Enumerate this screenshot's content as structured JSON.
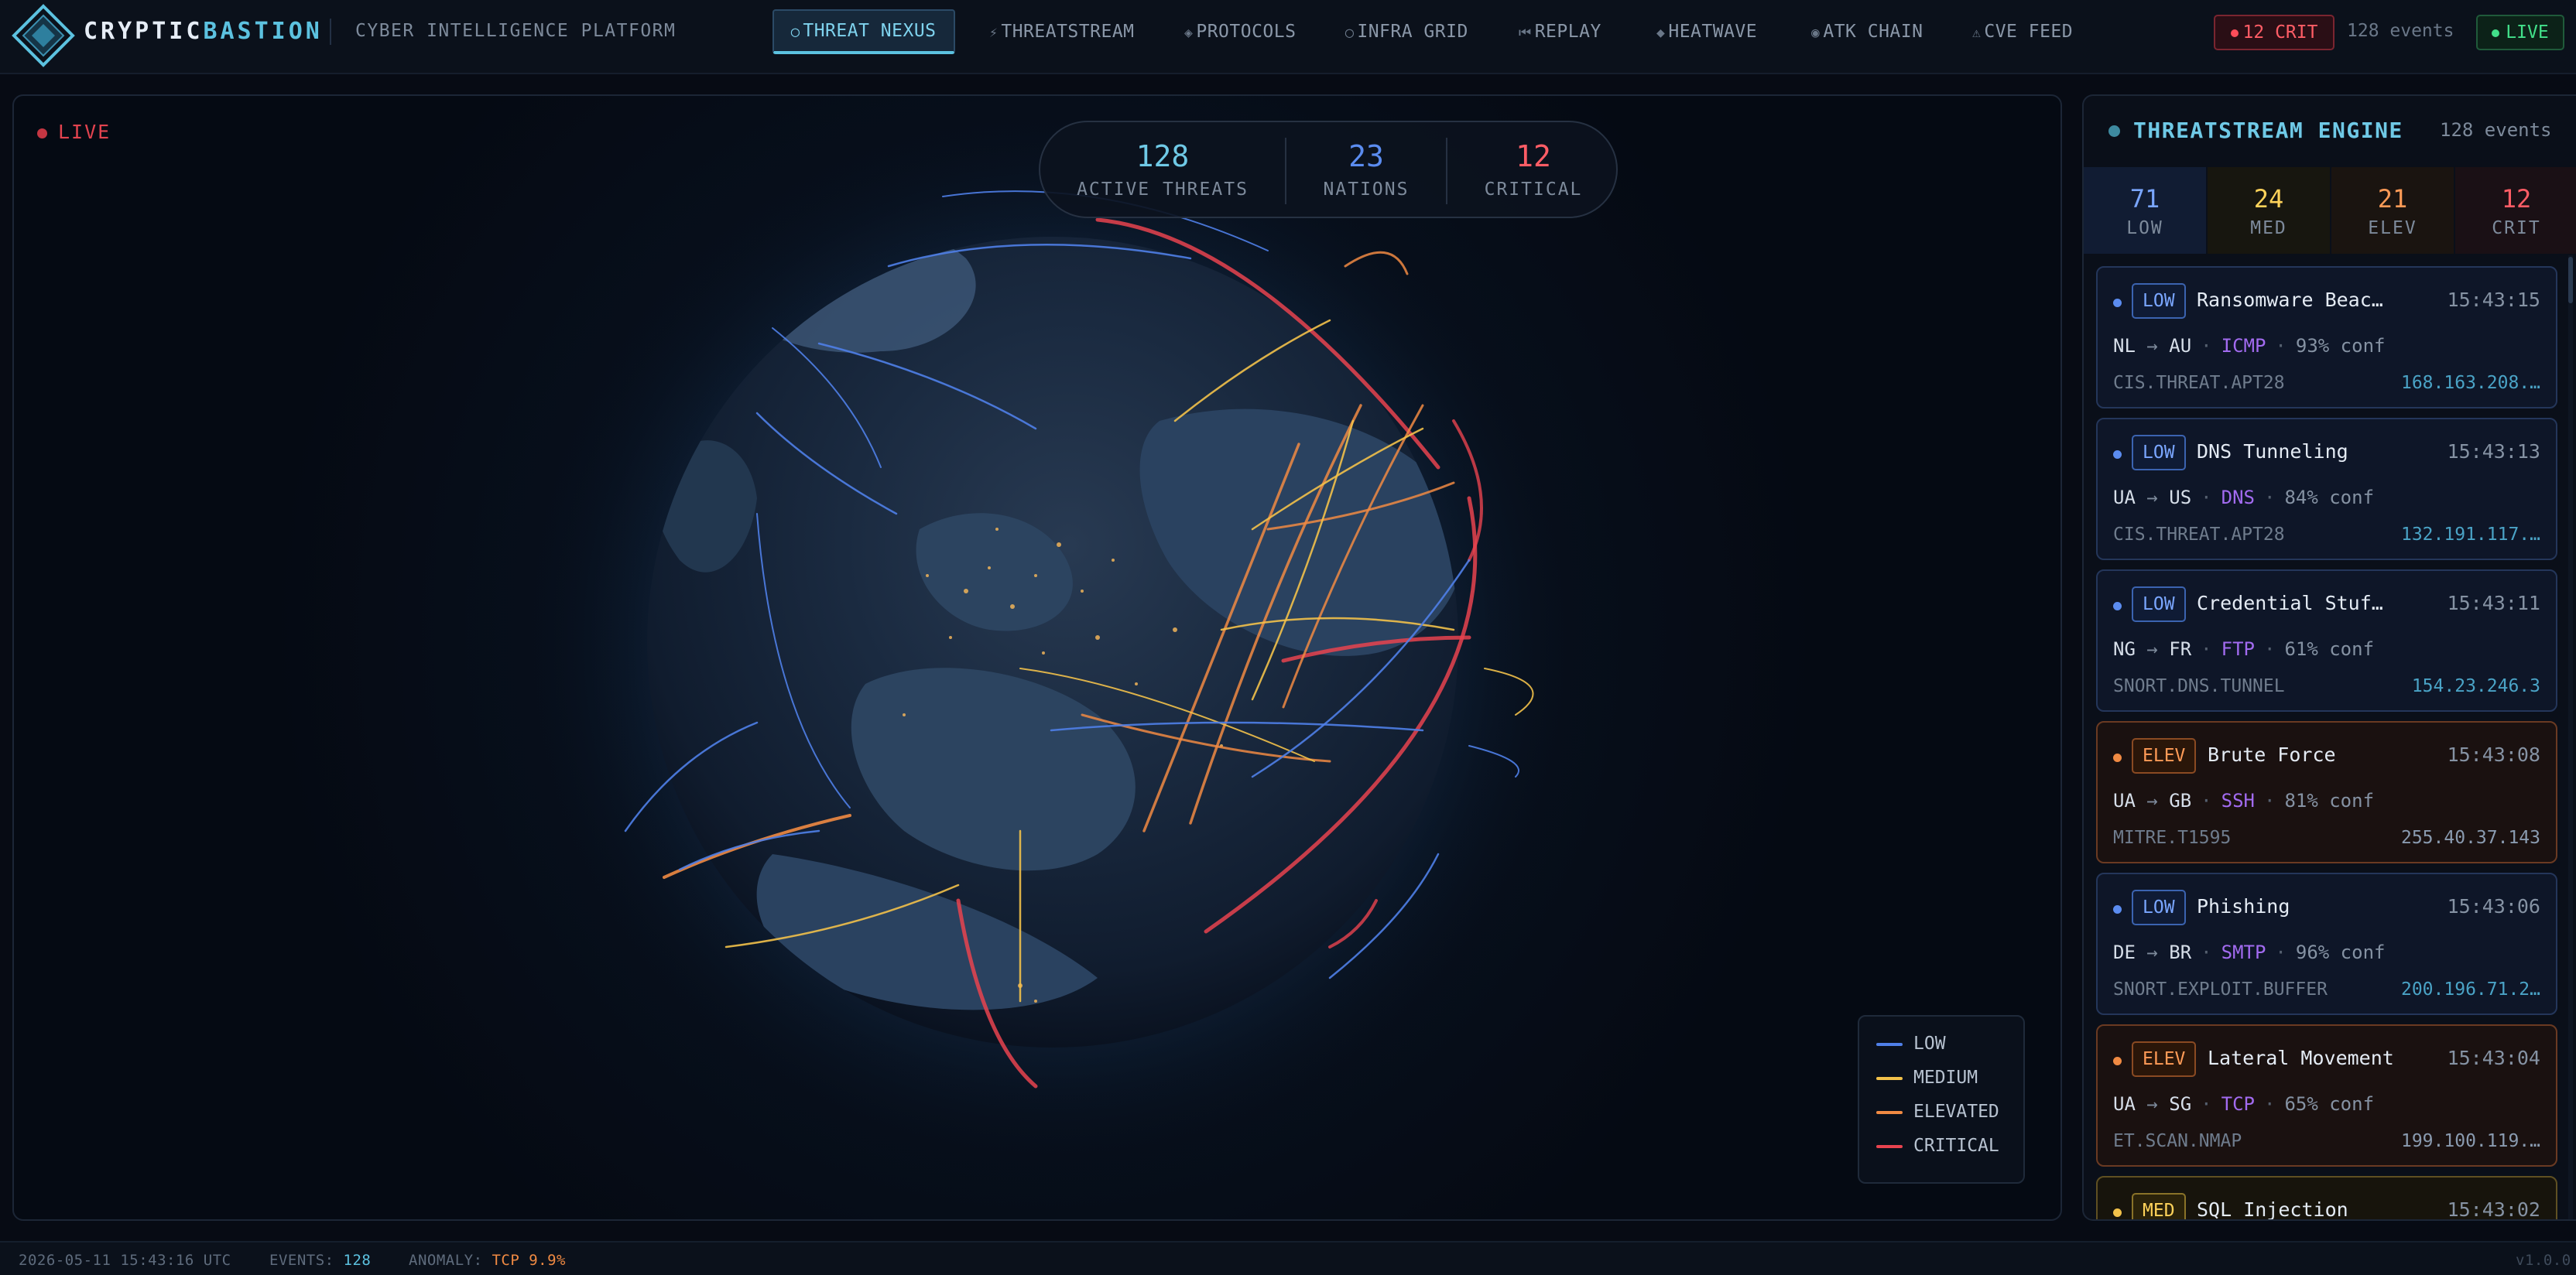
{
  "brand": {
    "part1": "CRYPTIC",
    "part2": "BASTION",
    "subtitle": "CYBER INTELLIGENCE PLATFORM"
  },
  "nav": {
    "tabs": [
      {
        "icon": "◯",
        "label": "THREAT NEXUS",
        "active": true
      },
      {
        "icon": "⚡",
        "label": "THREATSTREAM"
      },
      {
        "icon": "◈",
        "label": "PROTOCOLS"
      },
      {
        "icon": "◯",
        "label": "INFRA GRID"
      },
      {
        "icon": "⏮",
        "label": "REPLAY"
      },
      {
        "icon": "◆",
        "label": "HEATWAVE"
      },
      {
        "icon": "◉",
        "label": "ATK CHAIN"
      },
      {
        "icon": "⚠",
        "label": "CVE FEED"
      }
    ],
    "crit_badge": "12 CRIT",
    "events": "128 events",
    "live": "LIVE"
  },
  "viewport": {
    "live_label": "LIVE",
    "stats": [
      {
        "value": "128",
        "label": "ACTIVE THREATS",
        "color": "#6fc9e6"
      },
      {
        "value": "23",
        "label": "NATIONS",
        "color": "#5b8cf0"
      },
      {
        "value": "12",
        "label": "CRITICAL",
        "color": "#ff5d66"
      }
    ],
    "legend": [
      {
        "label": "LOW",
        "color": "#4f7fe8"
      },
      {
        "label": "MEDIUM",
        "color": "#f2c14a"
      },
      {
        "label": "ELEVATED",
        "color": "#f08a43"
      },
      {
        "label": "CRITICAL",
        "color": "#e8434f"
      }
    ]
  },
  "panel": {
    "title": "THREATSTREAM ENGINE",
    "count": "128 events",
    "severity": [
      {
        "value": "71",
        "label": "LOW",
        "color": "#7aa6ff",
        "bg": "#111c33"
      },
      {
        "value": "24",
        "label": "MED",
        "color": "#ffd35a",
        "bg": "#17160f"
      },
      {
        "value": "21",
        "label": "ELEV",
        "color": "#ff9b57",
        "bg": "#1a1410"
      },
      {
        "value": "12",
        "label": "CRIT",
        "color": "#ff5d66",
        "bg": "#1a1015"
      }
    ],
    "events": [
      {
        "sev": "LOW",
        "kind": "low",
        "title": "Ransomware Beac…",
        "time": "15:43:15",
        "src": "NL",
        "dst": "AU",
        "proto": "ICMP",
        "conf": "93% conf",
        "sig": "CIS.THREAT.APT28",
        "ip": "168.163.208.…"
      },
      {
        "sev": "LOW",
        "kind": "low",
        "title": "DNS Tunneling",
        "time": "15:43:13",
        "src": "UA",
        "dst": "US",
        "proto": "DNS",
        "conf": "84% conf",
        "sig": "CIS.THREAT.APT28",
        "ip": "132.191.117.…"
      },
      {
        "sev": "LOW",
        "kind": "low",
        "title": "Credential Stuf…",
        "time": "15:43:11",
        "src": "NG",
        "dst": "FR",
        "proto": "FTP",
        "conf": "61% conf",
        "sig": "SNORT.DNS.TUNNEL",
        "ip": "154.23.246.3"
      },
      {
        "sev": "ELEV",
        "kind": "elev",
        "title": "Brute Force",
        "time": "15:43:08",
        "src": "UA",
        "dst": "GB",
        "proto": "SSH",
        "conf": "81% conf",
        "sig": "MITRE.T1595",
        "ip": "255.40.37.143"
      },
      {
        "sev": "LOW",
        "kind": "low",
        "title": "Phishing",
        "time": "15:43:06",
        "src": "DE",
        "dst": "BR",
        "proto": "SMTP",
        "conf": "96% conf",
        "sig": "SNORT.EXPLOIT.BUFFER",
        "ip": "200.196.71.2…"
      },
      {
        "sev": "ELEV",
        "kind": "elev",
        "title": "Lateral Movement",
        "time": "15:43:04",
        "src": "UA",
        "dst": "SG",
        "proto": "TCP",
        "conf": "65% conf",
        "sig": "ET.SCAN.NMAP",
        "ip": "199.100.119.…"
      },
      {
        "sev": "MED",
        "kind": "med",
        "title": "SQL Injection",
        "time": "15:43:02",
        "src": "",
        "dst": "",
        "proto": "",
        "conf": "",
        "sig": "",
        "ip": ""
      }
    ]
  },
  "status": {
    "timestamp": "2026-05-11 15:43:16 UTC",
    "events_label": "EVENTS:",
    "events_value": "128",
    "anomaly_label": "ANOMALY:",
    "anomaly_value": "TCP 9.9%",
    "version": "v1.0.0"
  }
}
